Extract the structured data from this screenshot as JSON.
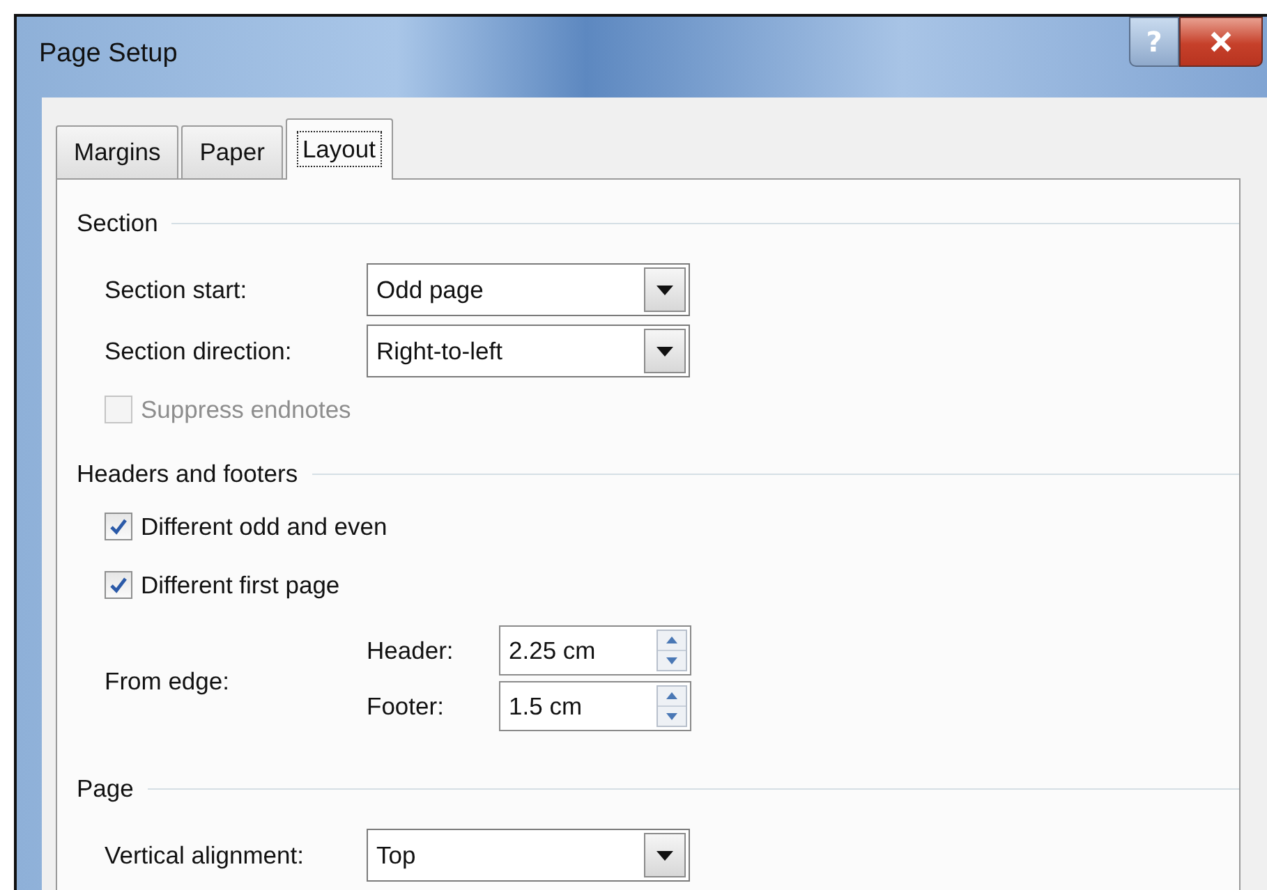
{
  "window": {
    "title": "Page Setup",
    "help_button": "?"
  },
  "tabs": [
    {
      "label": "Margins",
      "selected": false
    },
    {
      "label": "Paper",
      "selected": false
    },
    {
      "label": "Layout",
      "selected": true
    }
  ],
  "section": {
    "heading": "Section",
    "section_start": {
      "label": "Section start:",
      "value": "Odd page"
    },
    "section_direction": {
      "label": "Section direction:",
      "value": "Right-to-left"
    },
    "suppress_endnotes": {
      "label": "Suppress endnotes",
      "checked": false,
      "disabled": true
    }
  },
  "headers_and_footers": {
    "heading": "Headers and footers",
    "options": [
      {
        "label": "Different odd and even",
        "checked": true,
        "disabled": false
      },
      {
        "label": "Different first page",
        "checked": true,
        "disabled": false
      }
    ],
    "from_edge": {
      "label": "From edge:",
      "fields": [
        {
          "label": "Header:",
          "value": "2.25 cm"
        },
        {
          "label": "Footer:",
          "value": "1.5 cm"
        }
      ]
    }
  },
  "page": {
    "heading": "Page",
    "vertical_alignment": {
      "label": "Vertical alignment:",
      "value": "Top"
    }
  }
}
